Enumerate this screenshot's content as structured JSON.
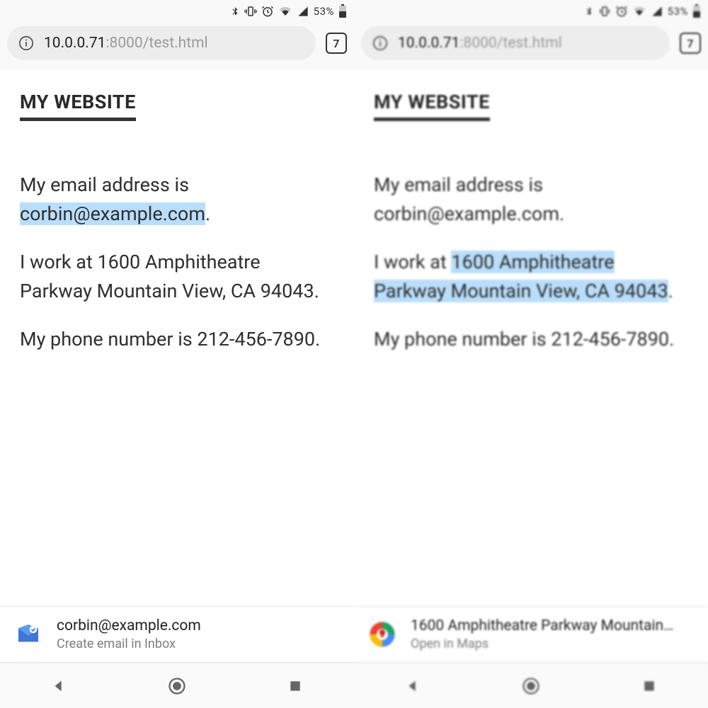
{
  "status": {
    "battery_pct": "53%"
  },
  "omnibox": {
    "url_host": "10.0.0.71",
    "url_rest": ":8000/test.html",
    "tab_count": "7"
  },
  "page": {
    "title": "MY WEBSITE",
    "line1a": "My",
    "line1b": "email",
    "line1c": "address",
    "line2a": "is",
    "email": "corbin@example.com",
    "line2c": ".",
    "para2_pre": "I work at ",
    "address": "1600 Amphitheatre Parkway Mountain View, CA 94043",
    "para2_post": ".",
    "para3_pre": "My phone number is ",
    "phone": "212-456-7890",
    "para3_post": "."
  },
  "left_suggestion": {
    "title": "corbin@example.com",
    "sub": "Create email in Inbox"
  },
  "right_suggestion": {
    "title": "1600 Amphitheatre Parkway Mountain…",
    "sub": "Open in Maps"
  }
}
